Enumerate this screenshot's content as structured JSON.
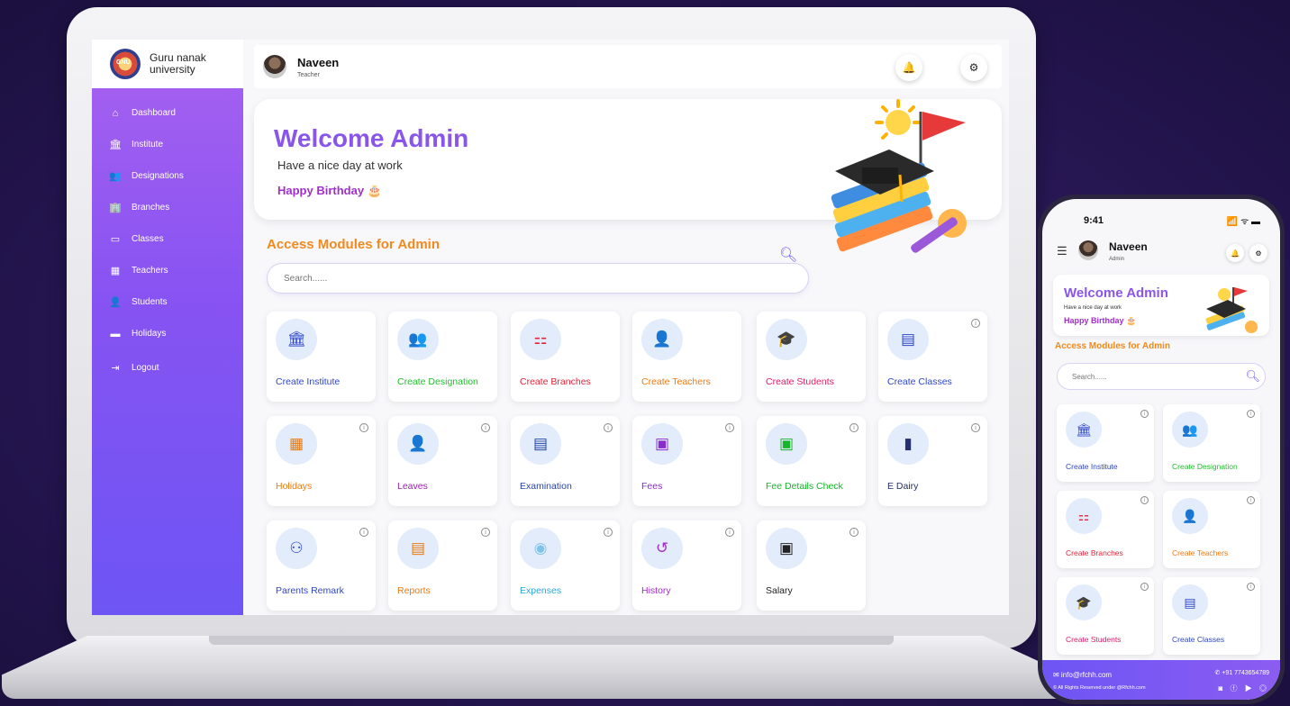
{
  "laptop": {
    "logo_text": "GNU",
    "university": [
      "Guru nanak",
      "university"
    ],
    "sidebar": [
      {
        "label": "Dashboard",
        "icon": "home-icon"
      },
      {
        "label": "Institute",
        "icon": "institute-icon"
      },
      {
        "label": "Designations",
        "icon": "designation-icon"
      },
      {
        "label": "Branches",
        "icon": "branches-icon"
      },
      {
        "label": "Classes",
        "icon": "classes-icon"
      },
      {
        "label": "Teachers",
        "icon": "teachers-icon"
      },
      {
        "label": "Students",
        "icon": "students-icon"
      },
      {
        "label": "Holidays",
        "icon": "holidays-icon"
      },
      {
        "label": "Logout",
        "icon": "logout-icon"
      }
    ],
    "header": {
      "name": "Naveen",
      "role": "Teacher"
    },
    "welcome": {
      "title": "Welcome Admin",
      "subtitle": "Have a nice day at work",
      "birthday": "Happy Birthday 🎂"
    },
    "access_title": "Access Modules for Admin",
    "search_placeholder": "Search......",
    "modules": [
      {
        "label": "Create Institute",
        "color": "#2f47c9",
        "icon": "🏛",
        "iconColor": "#2f47c9",
        "info": false
      },
      {
        "label": "Create Designation",
        "color": "#1fbf2a",
        "icon": "👥",
        "iconColor": "#1fbf2a",
        "info": false
      },
      {
        "label": "Create Branches",
        "color": "#e5233a",
        "icon": "⚏",
        "iconColor": "#e5233a",
        "info": false
      },
      {
        "label": "Create  Teachers",
        "color": "#f07a12",
        "icon": "👤",
        "iconColor": "#f07a12",
        "info": false
      },
      {
        "label": "Create Students",
        "color": "#e21b6c",
        "icon": "🎓",
        "iconColor": "#8b3fd9",
        "info": false
      },
      {
        "label": "Create  Classes",
        "color": "#2f47c9",
        "icon": "▤",
        "iconColor": "#2f47c9",
        "info": true
      },
      {
        "label": "Holidays",
        "color": "#e87a12",
        "icon": "▦",
        "iconColor": "#e87a12",
        "info": true
      },
      {
        "label": "Leaves",
        "color": "#9b1fb1",
        "icon": "👤",
        "iconColor": "#8b2fd9",
        "info": true
      },
      {
        "label": "Examination",
        "color": "#2746a8",
        "icon": "▤",
        "iconColor": "#2746a8",
        "info": true
      },
      {
        "label": "Fees",
        "color": "#8a2ad1",
        "icon": "▣",
        "iconColor": "#8a2ad1",
        "info": true
      },
      {
        "label": "Fee Details Check",
        "color": "#16b52a",
        "icon": "▣",
        "iconColor": "#16b52a",
        "info": true
      },
      {
        "label": "E Dairy",
        "color": "#26306e",
        "icon": "▮",
        "iconColor": "#26306e",
        "info": true
      },
      {
        "label": "Parents Remark",
        "color": "#2f47c9",
        "icon": "⚇",
        "iconColor": "#2f47c9",
        "info": true
      },
      {
        "label": "Reports",
        "color": "#e87a12",
        "icon": "▤",
        "iconColor": "#e87a12",
        "info": true
      },
      {
        "label": "Expenses",
        "color": "#2aa8d8",
        "icon": "◉",
        "iconColor": "#7fc4e8",
        "info": true
      },
      {
        "label": "History",
        "color": "#a12fc9",
        "icon": "↺",
        "iconColor": "#a12fc9",
        "info": true
      },
      {
        "label": "Salary",
        "color": "#222222",
        "icon": "▣",
        "iconColor": "#222222",
        "info": true
      }
    ]
  },
  "phone": {
    "time": "9:41",
    "status": "📶 ᯤ ▬",
    "header": {
      "name": "Naveen",
      "role": "Admin"
    },
    "welcome": {
      "title": "Welcome Admin",
      "subtitle": "Have a nice day at work",
      "birthday": "Happy Birthday 🎂"
    },
    "access_title": "Access Modules for Admin",
    "search_placeholder": "Search......",
    "modules": [
      {
        "label": "Create Institute",
        "color": "#2f47c9",
        "icon": "🏛",
        "iconColor": "#2f47c9"
      },
      {
        "label": "Create Designation",
        "color": "#1fbf2a",
        "icon": "👥",
        "iconColor": "#1fbf2a"
      },
      {
        "label": "Create Branches",
        "color": "#e5233a",
        "icon": "⚏",
        "iconColor": "#e5233a"
      },
      {
        "label": "Create  Teachers",
        "color": "#f07a12",
        "icon": "👤",
        "iconColor": "#f07a12"
      },
      {
        "label": "Create Students",
        "color": "#e21b6c",
        "icon": "🎓",
        "iconColor": "#8b3fd9"
      },
      {
        "label": "Create  Classes",
        "color": "#2f47c9",
        "icon": "▤",
        "iconColor": "#2f47c9"
      }
    ],
    "footer": {
      "email": "✉ info@rfchh.com",
      "phone": "✆ +91 7743654789",
      "rights": "© All Rights Reserved under @Rfchh.com",
      "social": "◙ ⓕ ▶ ◎"
    }
  }
}
